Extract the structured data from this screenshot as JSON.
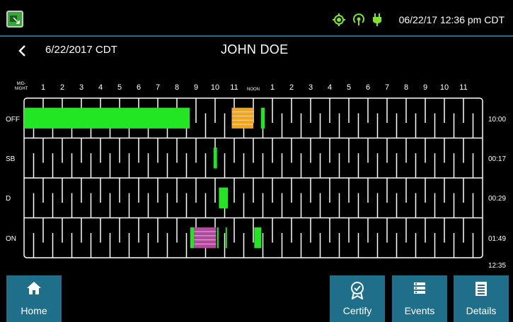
{
  "status_bar": {
    "clock": "06/22/17 12:36 pm CDT",
    "icons": [
      "app-icon",
      "gps-icon",
      "signal-icon",
      "plug-icon"
    ],
    "colors": {
      "accent": "#1f6f8a",
      "status_icon": "#7fe62a"
    }
  },
  "header": {
    "date": "6/22/2017 CDT",
    "driver_name": "JOHN DOE"
  },
  "log": {
    "hour_labels": [
      "MID-\nNIGHT",
      "1",
      "2",
      "3",
      "4",
      "5",
      "6",
      "7",
      "8",
      "9",
      "10",
      "11",
      "NOON",
      "1",
      "2",
      "3",
      "4",
      "5",
      "6",
      "7",
      "8",
      "9",
      "10",
      "11"
    ],
    "rows": [
      {
        "status": "OFF",
        "total": "10:00"
      },
      {
        "status": "SB",
        "total": "00:17"
      },
      {
        "status": "D",
        "total": "00:29"
      },
      {
        "status": "ON",
        "total": "01:49"
      }
    ],
    "grand_total": "12:35",
    "colors": {
      "duty": "#22e622",
      "edited_off": "#f2a51e",
      "edited_on": "#b04a9e",
      "grid": "#ffffff"
    },
    "segments": [
      {
        "row": 0,
        "start_hour": 0.0,
        "end_hour": 8.67,
        "type": "duty"
      },
      {
        "row": 0,
        "start_hour": 10.87,
        "end_hour": 12.0,
        "type": "edited_off"
      },
      {
        "row": 0,
        "start_hour": 12.4,
        "end_hour": 12.6,
        "type": "duty"
      },
      {
        "row": 1,
        "start_hour": 9.92,
        "end_hour": 10.1,
        "type": "duty"
      },
      {
        "row": 2,
        "start_hour": 10.2,
        "end_hour": 10.67,
        "type": "duty"
      },
      {
        "row": 3,
        "start_hour": 8.7,
        "end_hour": 8.9,
        "type": "duty"
      },
      {
        "row": 3,
        "start_hour": 8.9,
        "end_hour": 10.05,
        "type": "edited_on"
      },
      {
        "row": 3,
        "start_hour": 10.1,
        "end_hour": 10.18,
        "type": "duty"
      },
      {
        "row": 3,
        "start_hour": 10.55,
        "end_hour": 10.62,
        "type": "duty"
      },
      {
        "row": 3,
        "start_hour": 12.05,
        "end_hour": 12.42,
        "type": "duty"
      }
    ]
  },
  "toolbar": {
    "home_label": "Home",
    "certify_label": "Certify",
    "events_label": "Events",
    "details_label": "Details"
  }
}
